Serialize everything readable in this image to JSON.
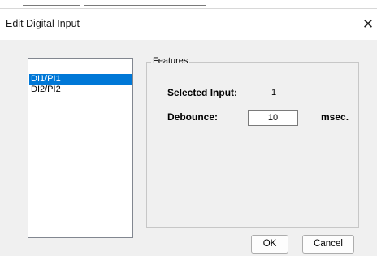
{
  "window": {
    "title": "Edit Digital Input",
    "close_glyph": "✕"
  },
  "inputs_list": {
    "items": [
      "DI1/PI1",
      "DI2/PI2"
    ],
    "selected_index": 0
  },
  "features": {
    "group_title": "Features",
    "selected_input_label": "Selected Input:",
    "selected_input_value": "1",
    "debounce_label": "Debounce:",
    "debounce_value": "10",
    "debounce_unit": "msec."
  },
  "buttons": {
    "ok_label": "OK",
    "cancel_label": "Cancel"
  },
  "colors": {
    "selection": "#0078d7",
    "dialog_bg": "#f0f0f0"
  },
  "icons": {
    "close": "close-icon"
  }
}
